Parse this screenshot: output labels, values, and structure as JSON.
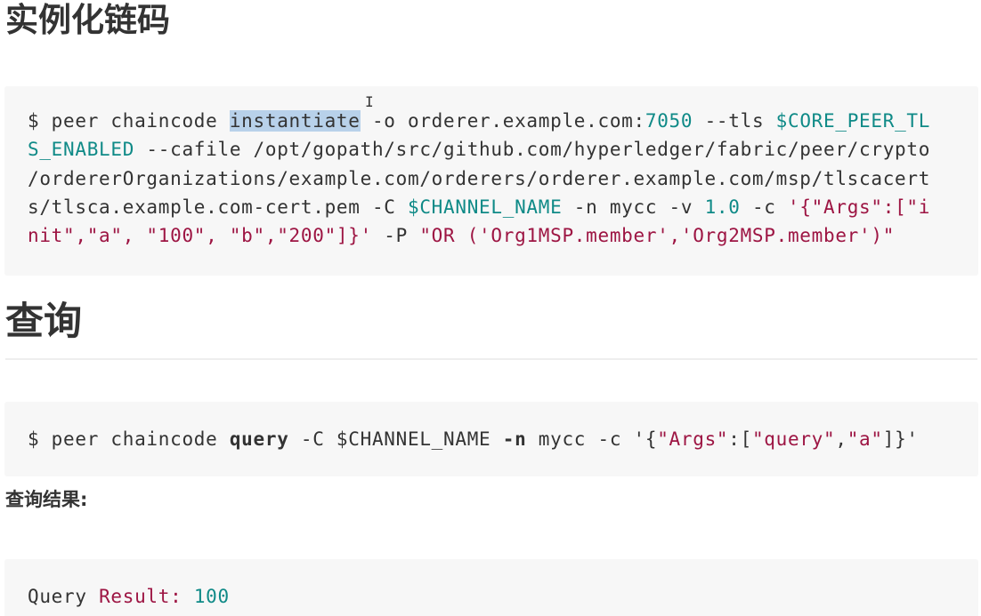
{
  "sections": {
    "instantiate_heading": "实例化链码",
    "query_heading": "查询",
    "result_heading": "查询结果:"
  },
  "code_blocks": [
    {
      "lines": [
        [
          {
            "text": "$ peer chaincode ",
            "style": "plain"
          },
          {
            "text": "instantiate",
            "style": "keyword"
          },
          {
            "text": " -o orderer.example.com:",
            "style": "plain"
          },
          {
            "text": "7050",
            "style": "number"
          },
          {
            "text": " --tls ",
            "style": "plain"
          },
          {
            "text": "$CORE_PEER_TL",
            "style": "variable"
          }
        ],
        [
          {
            "text": "S_ENABLED",
            "style": "variable"
          },
          {
            "text": " --cafile /opt/gopath/src/github.com/hyperledger/fabric/peer/crypto",
            "style": "plain"
          }
        ],
        [
          {
            "text": "/ordererOrganizations/example.com/orderers/orderer.example.com/msp/tlscacert",
            "style": "plain"
          }
        ],
        [
          {
            "text": "s/tlsca.example.com-cert.pem -C ",
            "style": "plain"
          },
          {
            "text": "$CHANNEL_NAME",
            "style": "variable"
          },
          {
            "text": " -n mycc -v ",
            "style": "plain"
          },
          {
            "text": "1.0",
            "style": "number"
          },
          {
            "text": " -c ",
            "style": "plain"
          },
          {
            "text": "'{\"Args\":[\"i",
            "style": "string"
          }
        ],
        [
          {
            "text": "nit\",\"a\", \"100\", \"b\",\"200\"]}'",
            "style": "string"
          },
          {
            "text": " -P ",
            "style": "plain"
          },
          {
            "text": "\"OR ('Org1MSP.member','Org2MSP.member')\"",
            "style": "string"
          }
        ]
      ]
    },
    {
      "lines": [
        [
          {
            "text": "$ peer chaincode ",
            "style": "plain"
          },
          {
            "text": "query",
            "style": "bold"
          },
          {
            "text": " -C $CHANNEL_NAME ",
            "style": "plain"
          },
          {
            "text": "-n",
            "style": "bold"
          },
          {
            "text": " mycc -c '{",
            "style": "plain"
          },
          {
            "text": "\"Args\"",
            "style": "string"
          },
          {
            "text": ":[",
            "style": "plain"
          },
          {
            "text": "\"query\"",
            "style": "string"
          },
          {
            "text": ",",
            "style": "plain"
          },
          {
            "text": "\"a\"",
            "style": "string"
          },
          {
            "text": "]}'",
            "style": "plain"
          }
        ]
      ]
    },
    {
      "lines": [
        [
          {
            "text": "Query ",
            "style": "plain"
          },
          {
            "text": "Result:",
            "style": "string"
          },
          {
            "text": " ",
            "style": "plain"
          },
          {
            "text": "100",
            "style": "number"
          }
        ]
      ]
    }
  ],
  "text_cursor": "I",
  "colors": {
    "code_background": "#f7f7f7",
    "selection_highlight": "#b8d1ea",
    "variable_teal": "#0f8a87",
    "string_crimson": "#9d1543",
    "heading_text": "#333333"
  }
}
